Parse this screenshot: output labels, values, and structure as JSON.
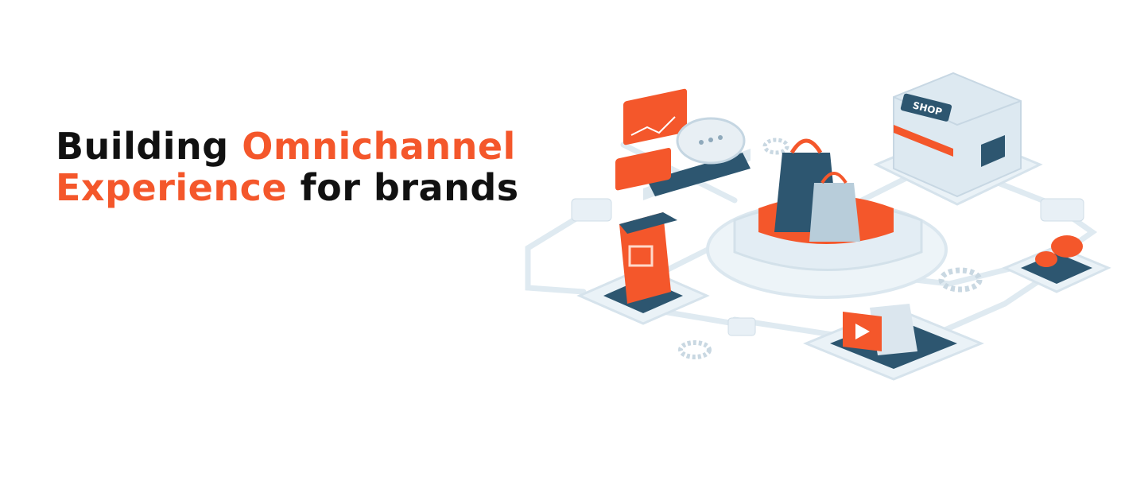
{
  "headline": {
    "line1_dark": "Building ",
    "line1_accent": "Omnichannel",
    "line2_accent": "Experience",
    "line2_dark": " for brands"
  },
  "illustration": {
    "shop_sign": "SHOP"
  },
  "colors": {
    "accent": "#f4572b",
    "dark_text": "#111111",
    "platform": "#e6f0f6",
    "navy": "#2d5670"
  },
  "icons": [
    "chart-board-icon",
    "chat-bubble-icon",
    "shopping-bags-icon",
    "storefront-icon",
    "mobile-shop-icon",
    "video-play-icon",
    "message-bubbles-icon",
    "gear-icon"
  ]
}
